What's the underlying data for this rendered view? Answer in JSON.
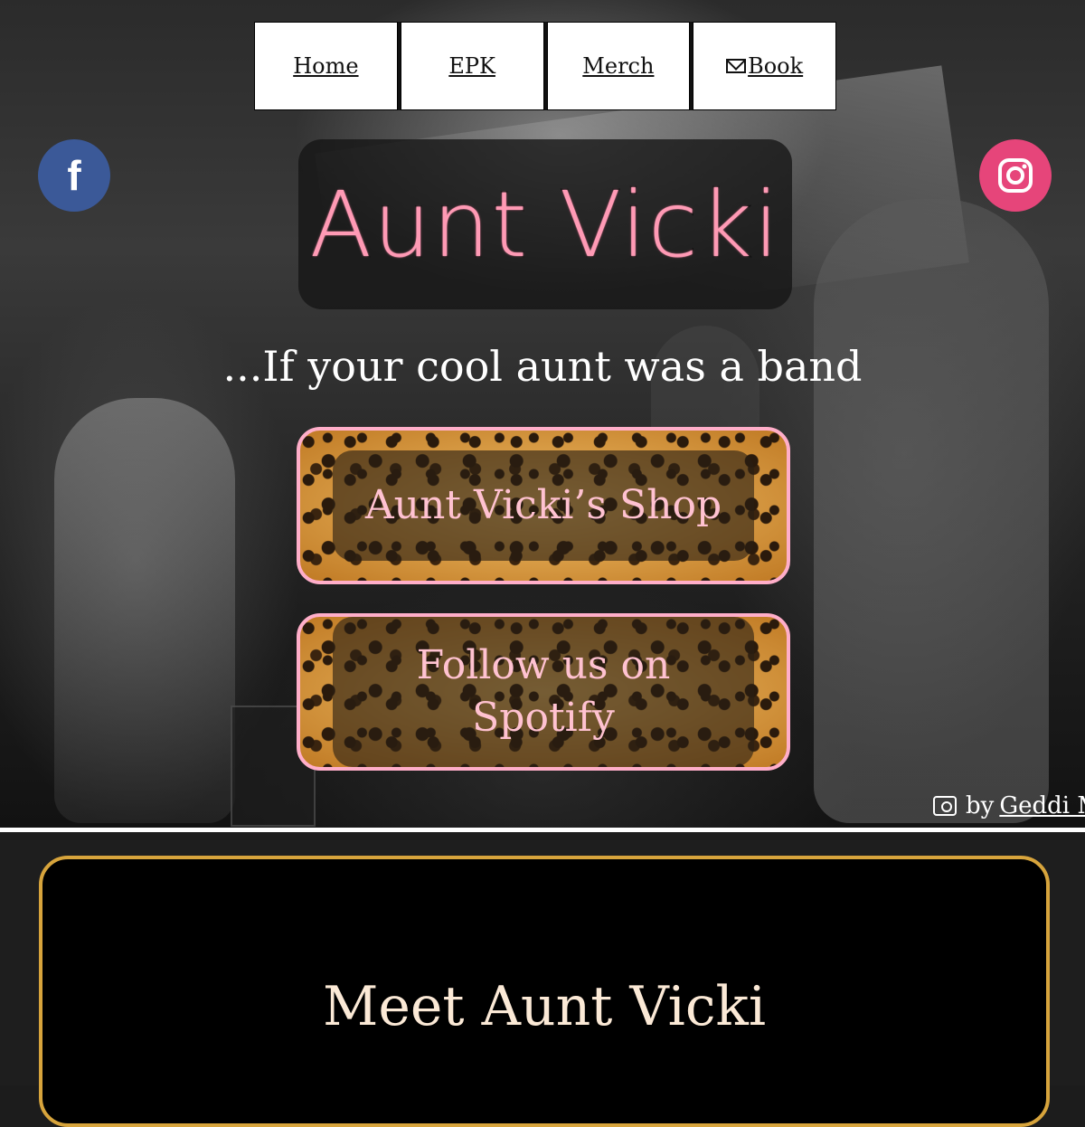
{
  "nav": {
    "items": [
      {
        "label": "Home"
      },
      {
        "label": "EPK"
      },
      {
        "label": "Merch"
      },
      {
        "label": "Book",
        "icon": "mail-icon"
      }
    ]
  },
  "social": {
    "facebook": {
      "icon": "facebook-icon",
      "color": "#3b5998"
    },
    "instagram": {
      "icon": "instagram-icon",
      "color": "#e6457a"
    }
  },
  "hero": {
    "title": "Aunt Vicki",
    "tagline": "...If your cool aunt was a band",
    "shop_button": "Aunt Vicki’s Shop",
    "spotify_button_line1": "Follow us on",
    "spotify_button_line2": "Spotify",
    "photo_credit_prefix": "by",
    "photo_credit_name": "Geddi Mc"
  },
  "meet": {
    "title": "Meet Aunt Vicki"
  },
  "colors": {
    "title_pink": "#ff9ab5",
    "button_border_pink": "#ffaec9",
    "meet_border_gold": "#d7a43c",
    "meet_title_cream": "#fbe9d6"
  }
}
